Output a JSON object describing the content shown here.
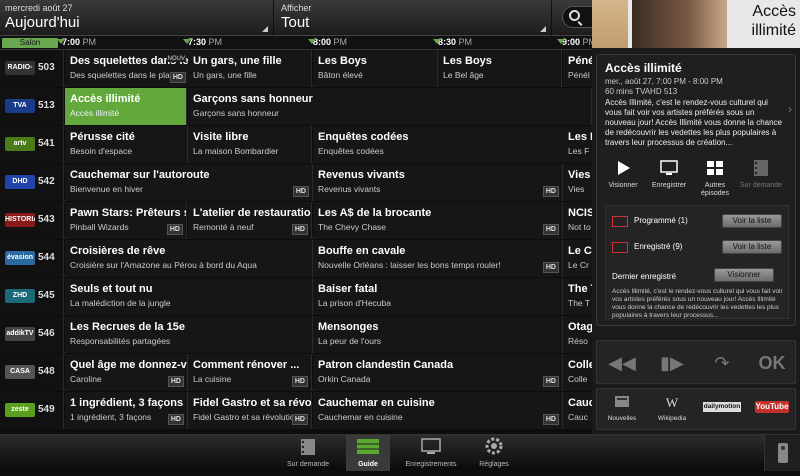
{
  "header": {
    "date_label": "mercredi août 27",
    "date_value": "Aujourd'hui",
    "filter_label": "Afficher",
    "filter_value": "Tout"
  },
  "timebar": {
    "salon_label": "Salon",
    "times": [
      {
        "t": "7:00",
        "ap": "PM"
      },
      {
        "t": "7:30",
        "ap": "PM"
      },
      {
        "t": "8:00",
        "ap": "PM"
      },
      {
        "t": "8:30",
        "ap": "PM"
      },
      {
        "t": "9:00",
        "ap": "PM"
      }
    ]
  },
  "channels": [
    {
      "num": "503",
      "logo": "RADIO-CANADA",
      "logo_color": "#333",
      "programs": [
        {
          "title": "Des squelettes dans le",
          "sub": "Des squelettes dans le placar",
          "nouv": "NOUV",
          "hd": "HD"
        },
        {
          "title": "Un gars, une fille",
          "sub": "Un gars, une fille"
        },
        {
          "title": "Les Boys",
          "sub": "Bâton élevé"
        },
        {
          "title": "Les Boys",
          "sub": "Le Bel âge"
        },
        {
          "title": "Péné",
          "sub": "Pénél"
        }
      ]
    },
    {
      "num": "513",
      "logo": "TVA",
      "logo_color": "#1a3a8a",
      "programs": [
        {
          "title": "Accès illimité",
          "sub": "Accès illimité",
          "selected": true
        },
        {
          "title": "Garçons sans honneur",
          "sub": "Garçons sans honneur"
        }
      ]
    },
    {
      "num": "541",
      "logo": "artv",
      "logo_color": "#4a7d1a",
      "programs": [
        {
          "title": "Pérusse cité",
          "sub": "Besoin d'espace"
        },
        {
          "title": "Visite libre",
          "sub": "La maison Bombardier"
        },
        {
          "title": "Enquêtes codées",
          "sub": "Enquêtes codées"
        },
        {
          "title": "Les F",
          "sub": "Les F"
        }
      ]
    },
    {
      "num": "542",
      "logo": "DHD",
      "logo_color": "#2244aa",
      "programs": [
        {
          "title": "Cauchemar sur l'autoroute",
          "sub": "Bienvenue en hiver",
          "hd": "HD"
        },
        {
          "title": "Revenus vivants",
          "sub": "Revenus vivants",
          "hd": "HD"
        },
        {
          "title": "Vies",
          "sub": "Vies"
        }
      ]
    },
    {
      "num": "543",
      "logo": "HISTORIA",
      "logo_color": "#8a1a1a",
      "programs": [
        {
          "title": "Pawn Stars: Prêteurs s",
          "sub": "Pinball Wizards",
          "hd": "HD"
        },
        {
          "title": "L'atelier de restauratio",
          "sub": "Remonté à neuf",
          "hd": "HD"
        },
        {
          "title": "Les A$ de la brocante",
          "sub": "The Chevy Chase",
          "hd": "HD"
        },
        {
          "title": "NCIS",
          "sub": "Not to"
        }
      ]
    },
    {
      "num": "544",
      "logo": "évasion",
      "logo_color": "#2a6aa0",
      "programs": [
        {
          "title": "Croisières de rêve",
          "sub": "Croisière sur l'Amazone au Pérou à bord du Aqua"
        },
        {
          "title": "Bouffe en cavale",
          "sub": "Nouvelle Orléans : laisser les bons temps rouler!",
          "hd": "HD"
        },
        {
          "title": "Le Cr",
          "sub": "Le Cr"
        }
      ]
    },
    {
      "num": "545",
      "logo": "ZHD",
      "logo_color": "#1a6a7a",
      "programs": [
        {
          "title": "Seuls et tout nu",
          "sub": "La malédiction de la jungle"
        },
        {
          "title": "Baiser fatal",
          "sub": "La prison d'Hecuba"
        },
        {
          "title": "The T",
          "sub": "The T"
        }
      ]
    },
    {
      "num": "546",
      "logo": "addikTV",
      "logo_color": "#444",
      "programs": [
        {
          "title": "Les Recrues de la 15e",
          "sub": "Responsabilités partagées"
        },
        {
          "title": "Mensonges",
          "sub": "La peur de l'ours"
        },
        {
          "title": "Otag",
          "sub": "Réso"
        }
      ]
    },
    {
      "num": "548",
      "logo": "CASA",
      "logo_color": "#555",
      "programs": [
        {
          "title": "Quel âge me donnez-vo",
          "sub": "Caroline",
          "hd": "HD"
        },
        {
          "title": "Comment rénover ...",
          "sub": "La cuisine",
          "hd": "HD"
        },
        {
          "title": "Patron clandestin Canada",
          "sub": "Orkin Canada",
          "hd": "HD"
        },
        {
          "title": "Colle",
          "sub": "Colle"
        }
      ]
    },
    {
      "num": "549",
      "logo": "zeste",
      "logo_color": "#5aa020",
      "programs": [
        {
          "title": "1 ingrédient, 3 façons",
          "sub": "1 ingrédient, 3 façons",
          "hd": "HD"
        },
        {
          "title": "Fidel Gastro et sa révol",
          "sub": "Fidel Gastro et sa révolution",
          "hd": "HD"
        },
        {
          "title": "Cauchemar en cuisine",
          "sub": "Cauchemar en cuisine",
          "hd": "HD"
        },
        {
          "title": "Cauc",
          "sub": "Cauc"
        }
      ]
    }
  ],
  "bottom_tabs": [
    {
      "label": "Sur demande"
    },
    {
      "label": "Guide"
    },
    {
      "label": "Enregistrements"
    },
    {
      "label": "Réglages"
    }
  ],
  "panel": {
    "promo_text_1": "Accès",
    "promo_text_2": "illimité",
    "popup": {
      "title": "Accès illimité",
      "datetime": "mer., août 27, 7:00 PM - 8:00 PM",
      "meta": "60 mins   TVAHD 513",
      "description": "Accès Illimité, c'est le rendez-vous culturel qui vous fait voir vos artistes préférés sous un nouveau jour! Accès Illimité vous donne la chance de redécouvrir les vedettes les plus populaires à travers leur processus de création...",
      "actions": [
        "Visionner",
        "Enregistrer",
        "Autres épisodes",
        "Sur demande"
      ],
      "programmed_label": "Programmé (1)",
      "recorded_label": "Enregistré (9)",
      "view_list": "Voir la liste",
      "last_recorded": "Dernier enregistré",
      "watch": "Visionner",
      "last_desc": "Accès Illimité, c'est le rendez-vous culturel qui vous fait voir vos artistes préférés sous un nouveau jour! Accès Illimité vous donne la chance de redécouvrir les vedettes les plus populaires à travers leur processus..."
    },
    "remote_ok": "OK",
    "apps": [
      "Nouvelles",
      "Wikipedia",
      "dailymotion",
      "YouTube"
    ]
  }
}
